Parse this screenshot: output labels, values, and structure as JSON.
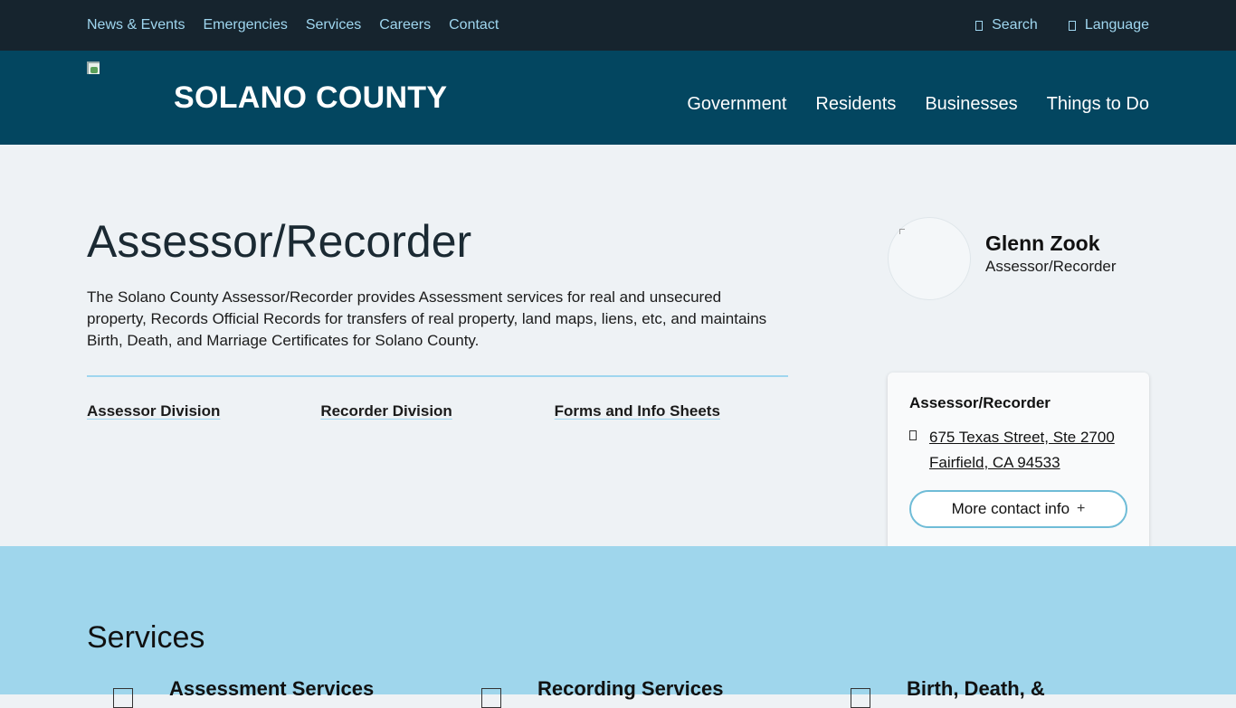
{
  "utility": {
    "links": [
      "News & Events",
      "Emergencies",
      "Services",
      "Careers",
      "Contact"
    ],
    "search_label": "Search",
    "language_label": "Language"
  },
  "header": {
    "brand": "SOLANO COUNTY",
    "nav": [
      "Government",
      "Residents",
      "Businesses",
      "Things to Do"
    ]
  },
  "main": {
    "title": "Assessor/Recorder",
    "intro": "The Solano County Assessor/Recorder provides Assessment services for real and unsecured property, Records Official Records for transfers of real property, land maps, liens, etc, and maintains Birth, Death, and Marriage Certificates for Solano County.",
    "division_links": [
      "Assessor Division",
      "Recorder Division",
      "Forms and Info Sheets"
    ]
  },
  "official": {
    "name": "Glenn Zook",
    "role": "Assessor/Recorder"
  },
  "contact": {
    "title": "Assessor/Recorder",
    "address_line1": "675 Texas Street, Ste 2700",
    "address_line2": "Fairfield, CA 94533",
    "more_label": "More contact info",
    "more_icon": "+"
  },
  "services": {
    "title": "Services",
    "items": [
      "Assessment Services",
      "Recording Services",
      "Birth, Death, &"
    ]
  },
  "colors": {
    "utility_bg": "#16242e",
    "header_bg": "#034660",
    "accent": "#9fd6ef",
    "services_bg": "#9fd6ec"
  }
}
